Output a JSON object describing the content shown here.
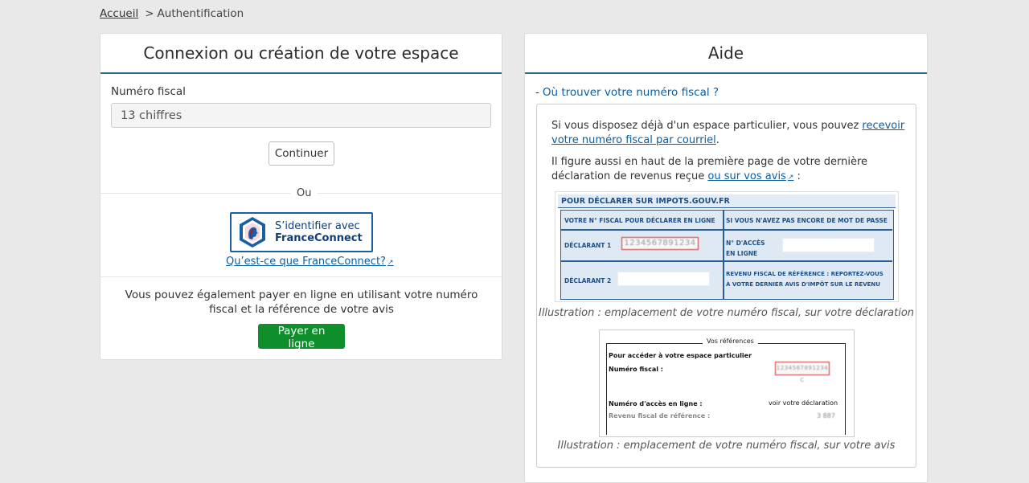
{
  "breadcrumb": {
    "home": "Accueil",
    "separator": ">",
    "current": "Authentification"
  },
  "login": {
    "title": "Connexion ou création de votre espace",
    "fiscal_label": "Numéro fiscal",
    "fiscal_placeholder": "13 chiffres",
    "continue_label": "Continuer",
    "or_label": "Ou",
    "fc_line1": "S’identifier avec",
    "fc_line2": "FranceConnect",
    "fc_link": "Qu’est-ce que FranceConnect?",
    "pay_text": "Vous pouvez également payer en ligne en utilisant votre numéro fiscal et la référence de votre avis",
    "pay_label": "Payer en ligne"
  },
  "help": {
    "title": "Aide",
    "accordion_toggle": "-",
    "accordion_title": "Où trouver votre numéro fiscal ?",
    "p1_text": "Si vous disposez déjà d'un espace particulier, vous pouvez ",
    "p1_link": "recevoir votre numéro fiscal par courriel",
    "p1_end": ".",
    "p2_text": "Il figure aussi en haut de la première page de votre dernière déclaration de revenus reçue ",
    "p2_link": "ou sur vos avis",
    "p2_end": " :",
    "illustration1": {
      "header": "POUR DÉCLARER SUR IMPOTS.GOUV.FR",
      "col1": "VOTRE N° FISCAL POUR DÉCLARER EN LIGNE",
      "col2": "SI VOUS N'AVEZ PAS ENCORE DE MOT DE PASSE",
      "declarant1": "DÉCLARANT 1",
      "declarant2": "DÉCLARANT 2",
      "number": "1234567891234",
      "acces_line1": "N° D'ACCÈS",
      "acces_line2": "EN LIGNE",
      "rfr_line1": "REVENU FISCAL DE RÉFÉRENCE : REPORTEZ-VOUS",
      "rfr_line2": "À VOTRE DERNIER AVIS D'IMPÔT SUR LE REVENU"
    },
    "caption1": "Illustration : emplacement de votre numéro fiscal, sur votre déclaration",
    "illustration2": {
      "legend": "Vos références",
      "line1": "Pour accéder à votre espace particulier",
      "fiscal_label": "Numéro fiscal :",
      "number": "1234567891234 C",
      "acces_label": "Numéro d'accès en ligne :",
      "acces_value": "voir votre déclaration",
      "rfr_label": "Revenu fiscal de référence :",
      "rfr_value": "3 887"
    },
    "caption2": "Illustration : emplacement de votre numéro fiscal, sur votre avis"
  },
  "colors": {
    "accent": "#2e6b8a",
    "link": "#0b5ea0",
    "pay": "#0f8f2c",
    "fc_blue": "#1a5fa3"
  }
}
